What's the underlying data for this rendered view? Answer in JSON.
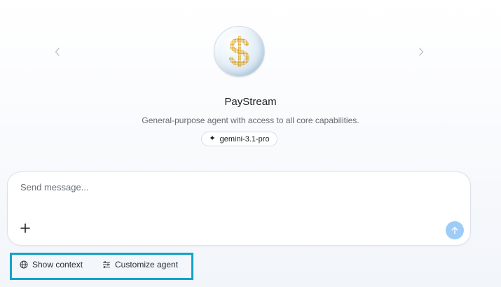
{
  "carousel": {
    "prev_icon": "chevron-left-icon",
    "next_icon": "chevron-right-icon"
  },
  "agent": {
    "name": "PayStream",
    "description": "General-purpose agent with access to all core capabilities.",
    "avatar_icon": "dollar-sign-icon",
    "avatar_symbol_color": "#d99a0e",
    "model": "gemini-3.1-pro",
    "model_icon": "sparkle-icon"
  },
  "composer": {
    "placeholder": "Send message...",
    "value": "",
    "add_icon": "plus-icon",
    "send_icon": "arrow-up-icon",
    "send_color": "#9dcdf7"
  },
  "actions": {
    "show_context": {
      "label": "Show context",
      "icon": "globe-icon"
    },
    "customize_agent": {
      "label": "Customize agent",
      "icon": "sliders-icon"
    }
  },
  "highlight_color": "#12a3c9"
}
